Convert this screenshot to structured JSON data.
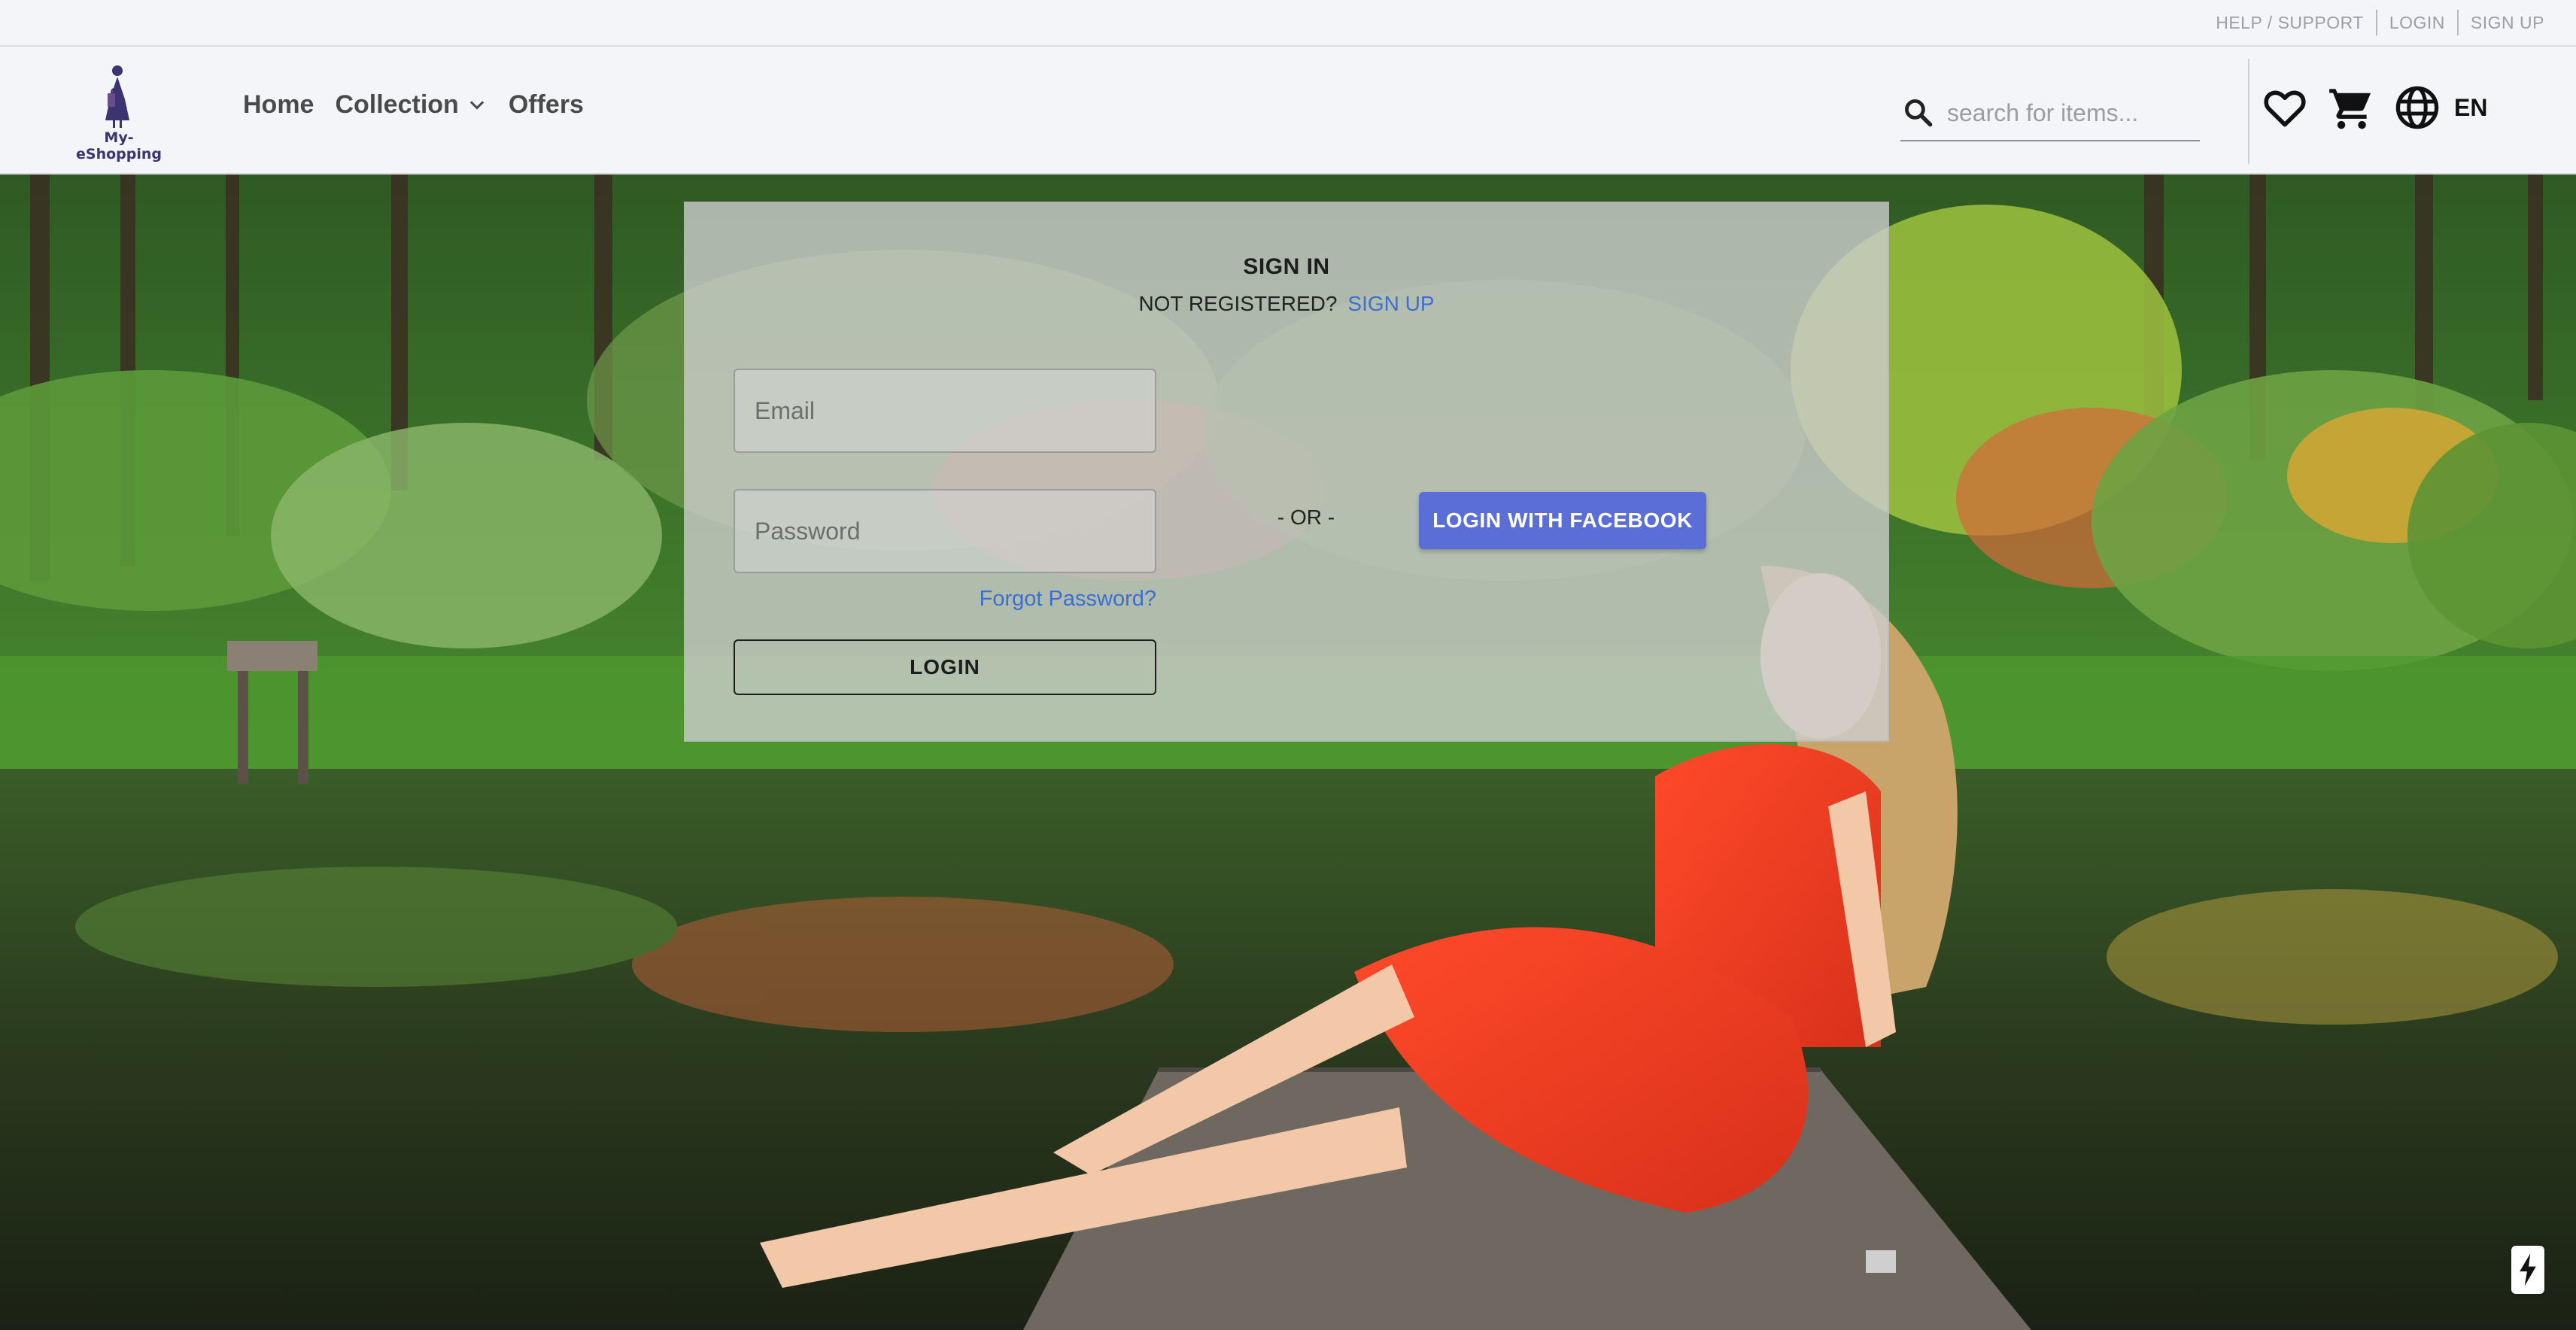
{
  "utility_bar": {
    "links": [
      "HELP / SUPPORT",
      "LOGIN",
      "SIGN UP"
    ]
  },
  "header": {
    "logo_text": "My-eShopping",
    "nav": {
      "home": "Home",
      "collection": "Collection",
      "offers": "Offers"
    },
    "search": {
      "placeholder": "search for items...",
      "value": ""
    },
    "language": "EN",
    "icons": [
      "search-icon",
      "heart-icon",
      "cart-icon",
      "globe-icon",
      "chevron-down-icon"
    ]
  },
  "signin": {
    "title": "SIGN IN",
    "not_registered": "NOT REGISTERED?",
    "signup_link": "SIGN UP",
    "email_placeholder": "Email",
    "password_placeholder": "Password",
    "forgot": "Forgot Password?",
    "login_button": "LOGIN",
    "or": "- OR -",
    "facebook_button": "LOGIN WITH FACEBOOK"
  },
  "colors": {
    "link": "#3b6fd2",
    "facebook": "#5b6ed8",
    "logo": "#3b3470"
  }
}
